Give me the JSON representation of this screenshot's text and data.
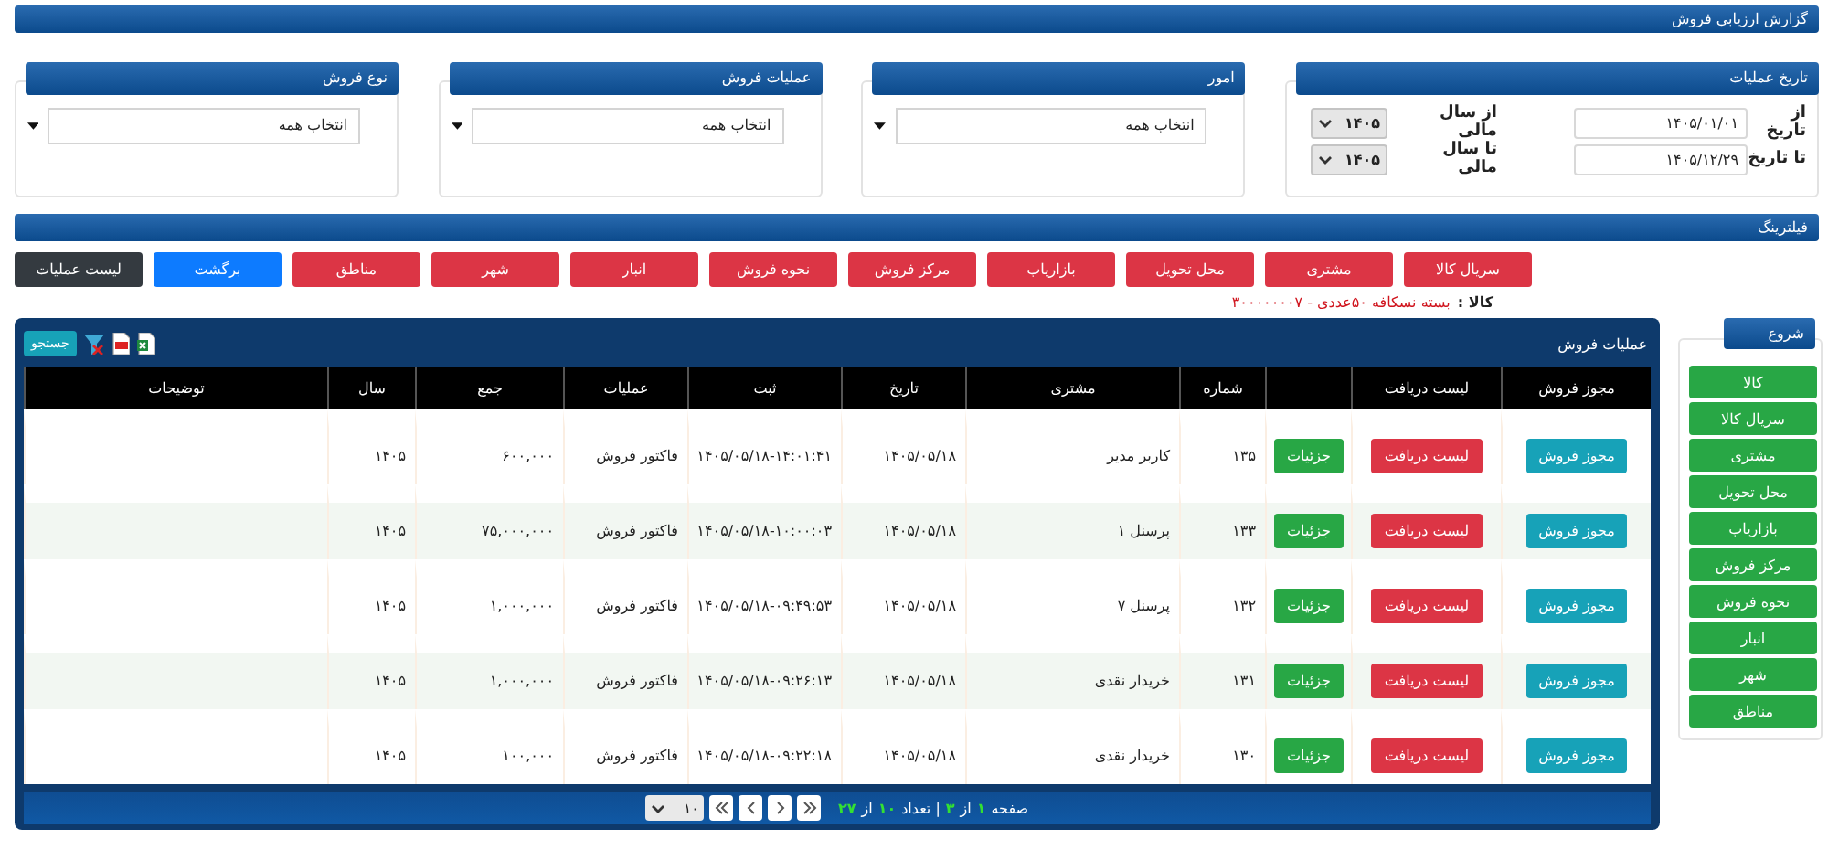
{
  "page_title": "گزارش ارزیابی فروش",
  "filter_panels": [
    {
      "kind": "dates",
      "title": "تاریخ عملیات",
      "rows": [
        {
          "date_label": "از تاریخ",
          "date": "۱۴۰۵/۰۱/۰۱",
          "year_label": "از سال مالی",
          "year": "۱۴۰۵"
        },
        {
          "date_label": "تا تاریخ",
          "date": "۱۴۰۵/۱۲/۲۹",
          "year_label": "تا سال مالی",
          "year": "۱۴۰۵"
        }
      ]
    },
    {
      "kind": "dropdown",
      "title": "امور",
      "value": "انتخاب همه"
    },
    {
      "kind": "dropdown",
      "title": "عملیات فروش",
      "value": "انتخاب همه"
    },
    {
      "kind": "dropdown",
      "title": "نوع فروش",
      "value": "انتخاب همه"
    }
  ],
  "filtering": {
    "title": "فیلترینگ",
    "buttons": [
      {
        "kind": "filter",
        "label": "سریال کالا"
      },
      {
        "kind": "filter",
        "label": "مشتری"
      },
      {
        "kind": "filter",
        "label": "محل تحویل"
      },
      {
        "kind": "filter",
        "label": "بازاریاب"
      },
      {
        "kind": "filter",
        "label": "مرکز فروش"
      },
      {
        "kind": "filter",
        "label": "نحوه فروش"
      },
      {
        "kind": "filter",
        "label": "انبار"
      },
      {
        "kind": "filter",
        "label": "شهر"
      },
      {
        "kind": "filter",
        "label": "مناطق"
      },
      {
        "kind": "back",
        "label": "برگشت"
      },
      {
        "kind": "list",
        "label": "لیست عملیات"
      }
    ],
    "active_filter": {
      "label": "کالا :",
      "value": "بسته نسکافه ۵۰عددی - ۳۰۰۰۰۰۰۰۷"
    }
  },
  "sidebar": {
    "title": "شروع",
    "items": [
      "کالا",
      "سریال کالا",
      "مشتری",
      "محل تحویل",
      "بازاریاب",
      "مرکز فروش",
      "نحوه فروش",
      "انبار",
      "شهر",
      "مناطق"
    ]
  },
  "sales_table": {
    "title": "عملیات فروش",
    "search_button": "جستجو",
    "columns": [
      {
        "kind": "text",
        "label": "مجوز فروش"
      },
      {
        "kind": "text",
        "label": "لیست دریافت"
      },
      {
        "kind": "blank"
      },
      {
        "kind": "text",
        "label": "شماره"
      },
      {
        "kind": "text",
        "label": "مشتری"
      },
      {
        "kind": "text",
        "label": "تاریخ"
      },
      {
        "kind": "text",
        "label": "ثبت"
      },
      {
        "kind": "text",
        "label": "عملیات"
      },
      {
        "kind": "text",
        "label": "جمع"
      },
      {
        "kind": "text",
        "label": "سال"
      },
      {
        "kind": "text",
        "label": "توضیحات"
      }
    ],
    "rows": [
      {
        "permit_button": "مجوز فروش",
        "receipts_button": "لیست دریافت",
        "details_button": "جزئیات",
        "number": "۱۳۵",
        "customer": "کاربر مدیر",
        "date": "۱۴۰۵/۰۵/۱۸",
        "registered": "۱۴۰۵/۰۵/۱۸-۱۴:۰۱:۴۱",
        "operation": "فاکتور فروش",
        "total": "۶۰۰,۰۰۰",
        "year": "۱۴۰۵"
      },
      {
        "permit_button": "مجوز فروش",
        "receipts_button": "لیست دریافت",
        "details_button": "جزئیات",
        "number": "۱۳۳",
        "customer": "پرسنل ۱",
        "date": "۱۴۰۵/۰۵/۱۸",
        "registered": "۱۴۰۵/۰۵/۱۸-۱۰:۰۰:۰۳",
        "operation": "فاکتور فروش",
        "total": "۷۵,۰۰۰,۰۰۰",
        "year": "۱۴۰۵"
      },
      {
        "permit_button": "مجوز فروش",
        "receipts_button": "لیست دریافت",
        "details_button": "جزئیات",
        "number": "۱۳۲",
        "customer": "پرسنل ۷",
        "date": "۱۴۰۵/۰۵/۱۸",
        "registered": "۱۴۰۵/۰۵/۱۸-۰۹:۴۹:۵۳",
        "operation": "فاکتور فروش",
        "total": "۱,۰۰۰,۰۰۰",
        "year": "۱۴۰۵"
      },
      {
        "permit_button": "مجوز فروش",
        "receipts_button": "لیست دریافت",
        "details_button": "جزئیات",
        "number": "۱۳۱",
        "customer": "خریدار نقدی",
        "date": "۱۴۰۵/۰۵/۱۸",
        "registered": "۱۴۰۵/۰۵/۱۸-۰۹:۲۶:۱۳",
        "operation": "فاکتور فروش",
        "total": "۱,۰۰۰,۰۰۰",
        "year": "۱۴۰۵"
      },
      {
        "permit_button": "مجوز فروش",
        "receipts_button": "لیست دریافت",
        "details_button": "جزئیات",
        "number": "۱۳۰",
        "customer": "خریدار نقدی",
        "date": "۱۴۰۵/۰۵/۱۸",
        "registered": "۱۴۰۵/۰۵/۱۸-۰۹:۲۲:۱۸",
        "operation": "فاکتور فروش",
        "total": "۱۰۰,۰۰۰",
        "year": "۱۴۰۵"
      }
    ],
    "pager": {
      "page_label": "صفحه",
      "page": "۱",
      "of_label": "از",
      "pages": "۳",
      "count_label": "| تعداد",
      "count": "۱۰",
      "of_label_2": "از",
      "total": "۲۷",
      "page_size": "۱۰"
    }
  }
}
